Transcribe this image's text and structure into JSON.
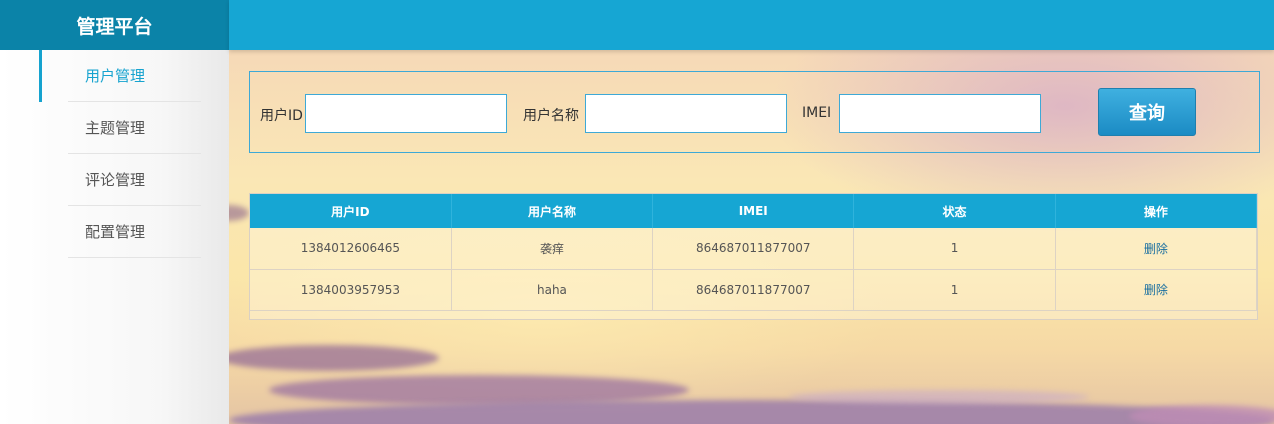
{
  "sidebar": {
    "brand": "管理平台",
    "items": [
      {
        "label": "用户管理",
        "active": true
      },
      {
        "label": "主题管理",
        "active": false
      },
      {
        "label": "评论管理",
        "active": false
      },
      {
        "label": "配置管理",
        "active": false
      }
    ]
  },
  "search": {
    "user_id_label": "用户ID",
    "user_id_value": "",
    "user_name_label": "用户名称",
    "user_name_value": "",
    "imei_label": "IMEI",
    "imei_value": "",
    "query_button": "查询"
  },
  "table": {
    "columns": [
      "用户ID",
      "用户名称",
      "IMEI",
      "状态",
      "操作"
    ],
    "rows": [
      {
        "user_id": "1384012606465",
        "user_name": "袭痒",
        "imei": "864687011877007",
        "status": "1",
        "action": "删除"
      },
      {
        "user_id": "1384003957953",
        "user_name": "haha",
        "imei": "864687011877007",
        "status": "1",
        "action": "删除"
      }
    ]
  },
  "colors": {
    "brand_bg": "#0b83a8",
    "accent": "#16a6d3"
  }
}
